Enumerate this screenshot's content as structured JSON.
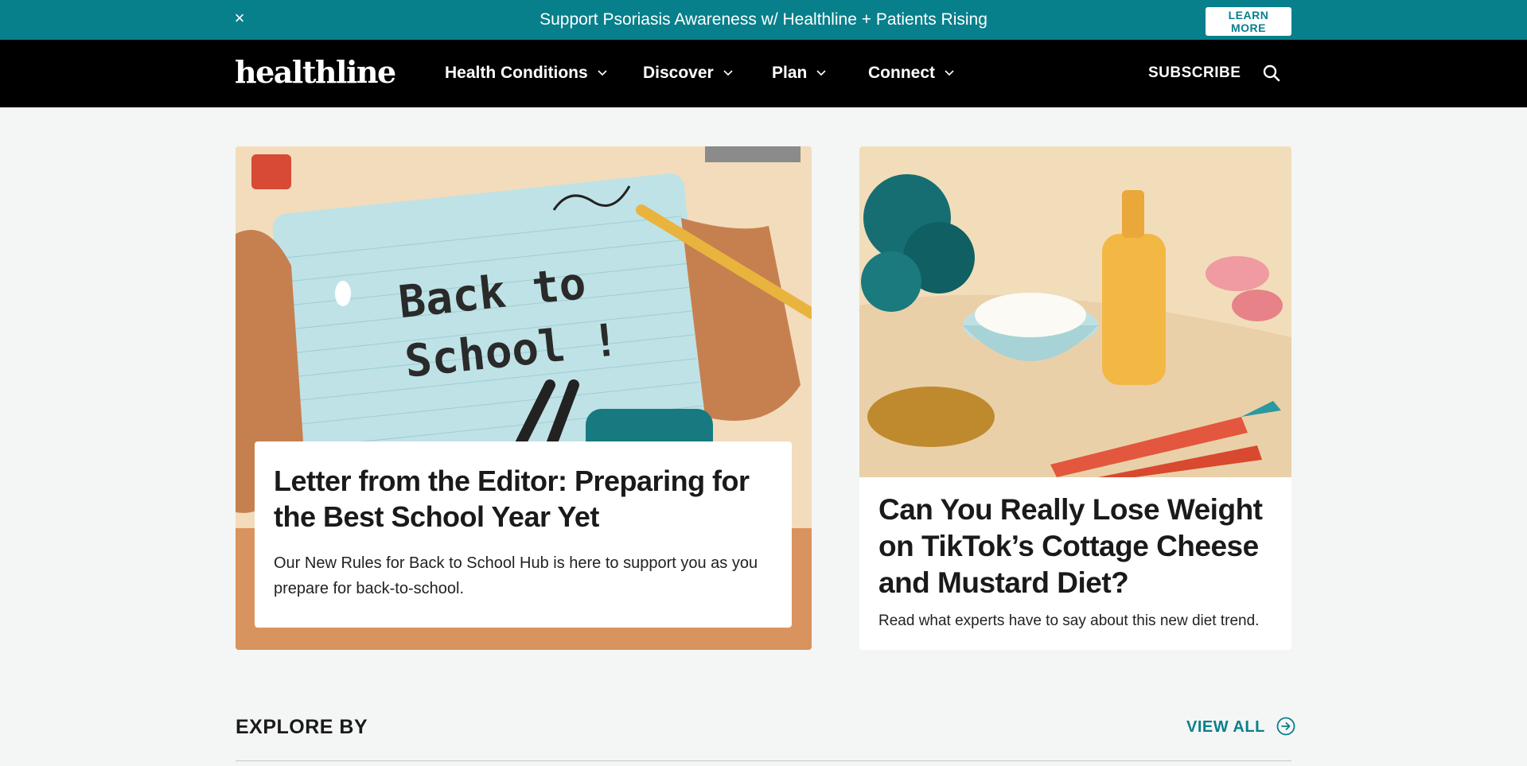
{
  "promo": {
    "close_icon": "×",
    "text": "Support Psoriasis Awareness w/ Healthline + Patients Rising",
    "button_label_line1": "LEARN",
    "button_label_line2": "MORE"
  },
  "nav": {
    "logo": "healthline",
    "items": [
      {
        "label": "Health Conditions"
      },
      {
        "label": "Discover"
      },
      {
        "label": "Plan"
      },
      {
        "label": "Connect"
      }
    ],
    "subscribe": "SUBSCRIBE",
    "search_icon": "search-icon"
  },
  "cards": {
    "left": {
      "image_text_line1": "Back to",
      "image_text_line2": "School !",
      "title": "Letter from the Editor: Preparing for the Best School Year Yet",
      "description": "Our New Rules for Back to School Hub is here to support you as you prepare for back-to-school."
    },
    "right": {
      "title": "Can You Really Lose Weight on TikTok’s Cottage Cheese and Mustard Diet?",
      "description": "Read what experts have to say about this new diet trend."
    }
  },
  "explore": {
    "heading": "EXPLORE BY",
    "view_all": "VIEW ALL"
  },
  "colors": {
    "brand_teal": "#08808c",
    "nav_bg": "#000000",
    "page_bg": "#f4f6f5"
  }
}
